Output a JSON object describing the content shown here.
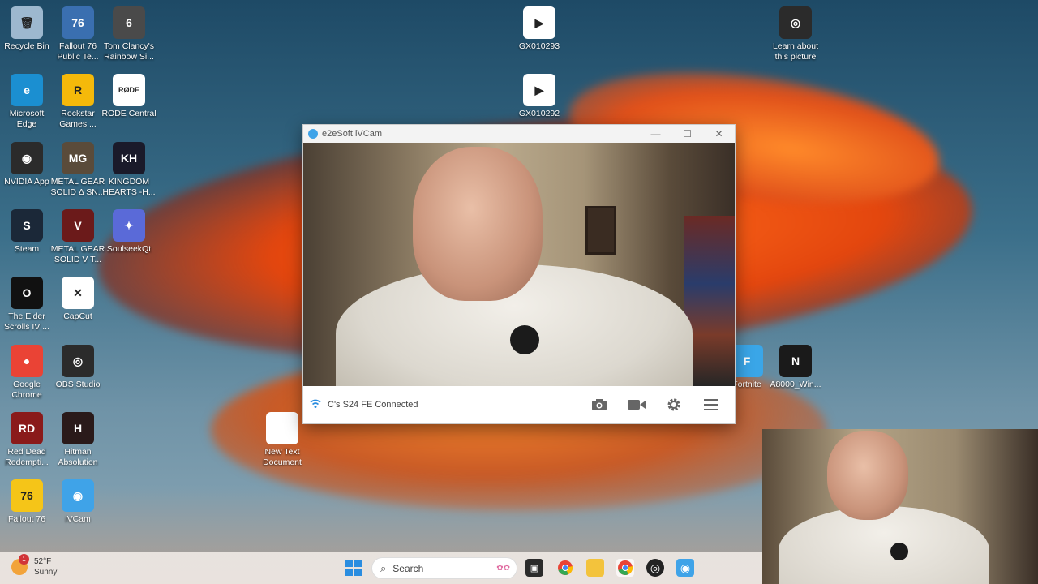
{
  "desktop": {
    "icons": [
      {
        "label": "Recycle Bin",
        "icon": "recycle-bin-icon",
        "color": "#9db8cf",
        "glyph": "🗑"
      },
      {
        "label": "Fallout 76\nPublic Te...",
        "icon": "fallout76-pts-icon",
        "color": "#3a6fb0",
        "glyph": "76"
      },
      {
        "label": "Tom Clancy's\nRainbow Si...",
        "icon": "rainbow-six-icon",
        "color": "#4a4a4a",
        "glyph": "6"
      },
      {
        "label": "GX010293",
        "icon": "video-file-icon",
        "color": "#ffffff",
        "glyph": "▶"
      },
      {
        "label": "Learn about\nthis picture",
        "icon": "learn-picture-icon",
        "color": "#2b2b2b",
        "glyph": "◎"
      },
      {
        "label": "Microsoft\nEdge",
        "icon": "edge-icon",
        "color": "#1b8fd1",
        "glyph": "e"
      },
      {
        "label": "Rockstar\nGames ...",
        "icon": "rockstar-icon",
        "color": "#f5b90a",
        "glyph": "R"
      },
      {
        "label": "RODE Central",
        "icon": "rode-icon",
        "color": "#ffffff",
        "glyph": "RØDE"
      },
      {
        "label": "GX010292",
        "icon": "video-file-icon",
        "color": "#ffffff",
        "glyph": "▶"
      },
      {
        "label": "NVIDIA App",
        "icon": "nvidia-icon",
        "color": "#2b2b2b",
        "glyph": "◉"
      },
      {
        "label": "METAL GEAR\nSOLID Δ SN...",
        "icon": "mgs-delta-icon",
        "color": "#5a4b3a",
        "glyph": "MG"
      },
      {
        "label": "KINGDOM\nHEARTS -H...",
        "icon": "kingdom-hearts-icon",
        "color": "#1a1a2a",
        "glyph": "KH"
      },
      {
        "label": "Steam",
        "icon": "steam-icon",
        "color": "#1b2838",
        "glyph": "S"
      },
      {
        "label": "METAL GEAR\nSOLID V T...",
        "icon": "mgsv-icon",
        "color": "#6b1a1a",
        "glyph": "V"
      },
      {
        "label": "SoulseekQt",
        "icon": "soulseek-icon",
        "color": "#5a6ad8",
        "glyph": "✦"
      },
      {
        "label": "The Elder\nScrolls IV ...",
        "icon": "elder-scrolls-icon",
        "color": "#111111",
        "glyph": "O"
      },
      {
        "label": "CapCut",
        "icon": "capcut-icon",
        "color": "#ffffff",
        "glyph": "✕"
      },
      {
        "label": "Google\nChrome",
        "icon": "chrome-icon",
        "color": "#ea4335",
        "glyph": "●"
      },
      {
        "label": "OBS Studio",
        "icon": "obs-icon",
        "color": "#2b2b2b",
        "glyph": "◎"
      },
      {
        "label": "New Text\nDocument",
        "icon": "text-document-icon",
        "color": "#ffffff",
        "glyph": ""
      },
      {
        "label": "Red Dead\nRedempti...",
        "icon": "red-dead-icon",
        "color": "#8a1a1a",
        "glyph": "RD"
      },
      {
        "label": "Hitman\nAbsolution",
        "icon": "hitman-icon",
        "color": "#2a1a1a",
        "glyph": "H"
      },
      {
        "label": "Fallout 76",
        "icon": "fallout76-icon",
        "color": "#f5c518",
        "glyph": "76"
      },
      {
        "label": "iVCam",
        "icon": "ivcam-icon",
        "color": "#3fa3e8",
        "glyph": "◉"
      },
      {
        "label": "Fortnite",
        "icon": "fortnite-icon",
        "color": "#3aa6e8",
        "glyph": "F"
      },
      {
        "label": "A8000_Win...",
        "icon": "installer-icon",
        "color": "#1a1a1a",
        "glyph": "N"
      }
    ]
  },
  "ivcam": {
    "title": "e2eSoft iVCam",
    "status": "C's S24 FE Connected",
    "minimize": "—",
    "maximize": "☐",
    "close": "✕"
  },
  "taskbar": {
    "temperature": "52°F",
    "condition": "Sunny",
    "weather_badge": "1",
    "search_placeholder": "Search"
  }
}
